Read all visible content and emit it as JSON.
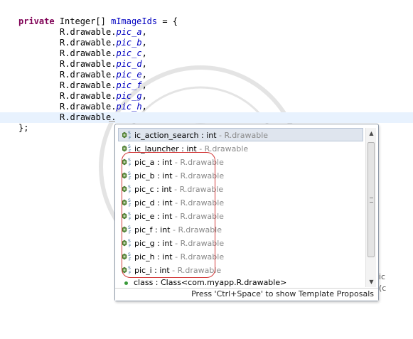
{
  "editor": {
    "lines": [
      {
        "kw": "private",
        "rest": " Integer[] ",
        "field": "mImageIds",
        "tail": " = {"
      },
      {
        "prefix": "R.drawable.",
        "item": "pic_a",
        "tail": ","
      },
      {
        "prefix": "R.drawable.",
        "item": "pic_b",
        "tail": ","
      },
      {
        "prefix": "R.drawable.",
        "item": "pic_c",
        "tail": ","
      },
      {
        "prefix": "R.drawable.",
        "item": "pic_d",
        "tail": ","
      },
      {
        "prefix": "R.drawable.",
        "item": "pic_e",
        "tail": ","
      },
      {
        "prefix": "R.drawable.",
        "item": "pic_f",
        "tail": ","
      },
      {
        "prefix": "R.drawable.",
        "item": "pic_g",
        "tail": ","
      },
      {
        "prefix": "R.drawable.",
        "item": "pic_h",
        "tail": ","
      },
      {
        "prefix": "R.drawable.",
        "item": "",
        "tail": ""
      },
      {
        "text": "};"
      }
    ]
  },
  "content_assist": {
    "proposals": [
      {
        "name": "ic_action_search : int",
        "qualifier": " - R.drawable",
        "icon": "static-field-icon",
        "selected": true
      },
      {
        "name": "ic_launcher : int",
        "qualifier": " - R.drawable",
        "icon": "static-field-icon"
      },
      {
        "name": "pic_a : int",
        "qualifier": " - R.drawable",
        "icon": "static-field-icon"
      },
      {
        "name": "pic_b : int",
        "qualifier": " - R.drawable",
        "icon": "static-field-icon"
      },
      {
        "name": "pic_c : int",
        "qualifier": " - R.drawable",
        "icon": "static-field-icon"
      },
      {
        "name": "pic_d : int",
        "qualifier": " - R.drawable",
        "icon": "static-field-icon"
      },
      {
        "name": "pic_e : int",
        "qualifier": " - R.drawable",
        "icon": "static-field-icon"
      },
      {
        "name": "pic_f : int",
        "qualifier": " - R.drawable",
        "icon": "static-field-icon"
      },
      {
        "name": "pic_g : int",
        "qualifier": " - R.drawable",
        "icon": "static-field-icon"
      },
      {
        "name": "pic_h : int",
        "qualifier": " - R.drawable",
        "icon": "static-field-icon"
      },
      {
        "name": "pic_i : int",
        "qualifier": " - R.drawable",
        "icon": "static-field-icon"
      }
    ],
    "class_item": {
      "label": "class : Class<com.myapp.R.drawable>",
      "icon": "class-dot-icon"
    },
    "status": "Press 'Ctrl+Space' to show Template Proposals"
  },
  "colors": {
    "keyword": "#7f0055",
    "field": "#0000c0",
    "selection": "#dfe5ee",
    "highlight_outline": "#d23a3a",
    "current_line": "#e8f2fe"
  }
}
